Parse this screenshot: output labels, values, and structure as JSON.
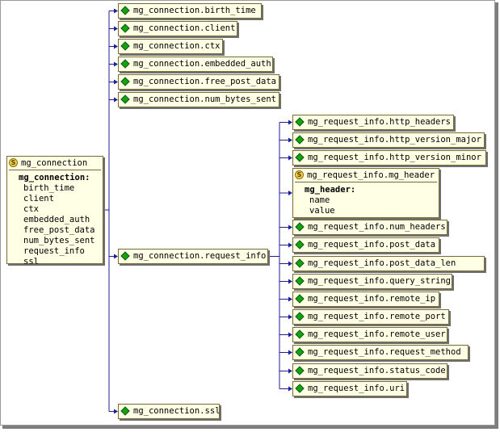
{
  "root": {
    "title": "mg_connection",
    "struct_label": "mg_connection:",
    "fields": [
      "birth_time",
      "client",
      "ctx",
      "embedded_auth",
      "free_post_data",
      "num_bytes_sent",
      "request_info",
      "ssl"
    ]
  },
  "connection_members": [
    "mg_connection.birth_time",
    "mg_connection.client",
    "mg_connection.ctx",
    "mg_connection.embedded_auth",
    "mg_connection.free_post_data",
    "mg_connection.num_bytes_sent",
    "mg_connection.request_info",
    "mg_connection.ssl"
  ],
  "request_info_members": [
    "mg_request_info.http_headers",
    "mg_request_info.http_version_major",
    "mg_request_info.http_version_minor",
    "mg_request_info.num_headers",
    "mg_request_info.post_data",
    "mg_request_info.post_data_len",
    "mg_request_info.query_string",
    "mg_request_info.remote_ip",
    "mg_request_info.remote_port",
    "mg_request_info.remote_user",
    "mg_request_info.request_method",
    "mg_request_info.status_code",
    "mg_request_info.uri"
  ],
  "mg_header": {
    "title": "mg_request_info.mg_header",
    "struct_label": "mg_header:",
    "fields": [
      "name",
      "value"
    ]
  },
  "icons": {
    "member": "green-diamond-icon",
    "struct": "struct-s-icon"
  },
  "colors": {
    "node_fill": "#ffffe6",
    "node_border": "#7a6a33",
    "wire": "#1e1e96",
    "member_icon": "#18a018",
    "struct_icon": "#f3d24a"
  }
}
